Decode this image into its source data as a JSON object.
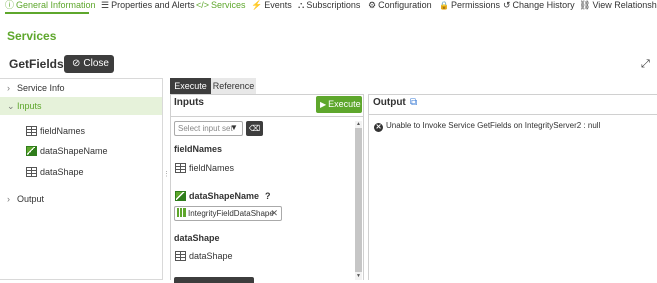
{
  "nav": {
    "tabs": [
      {
        "label": "General Information",
        "icon": "info-circle-icon",
        "glyph": "ⓘ"
      },
      {
        "label": "Properties and Alerts",
        "icon": "list-icon",
        "glyph": "☰"
      },
      {
        "label": "Services",
        "icon": "code-icon",
        "glyph": "</>"
      },
      {
        "label": "Events",
        "icon": "lightning-icon",
        "glyph": "⚡"
      },
      {
        "label": "Subscriptions",
        "icon": "subscriptions-icon",
        "glyph": "⛬"
      },
      {
        "label": "Configuration",
        "icon": "gear-icon",
        "glyph": "⚙"
      },
      {
        "label": "Permissions",
        "icon": "lock-icon",
        "glyph": "🔒"
      },
      {
        "label": "Change History",
        "icon": "history-icon",
        "glyph": "↺"
      },
      {
        "label": "View Relationships",
        "icon": "relationships-icon",
        "glyph": "⛓"
      }
    ],
    "active_tab": "Services"
  },
  "page": {
    "section_title": "Services",
    "service_name": "GetFields",
    "close_label": "Close",
    "expand_icon": "expand-arrows-icon"
  },
  "left_panel": {
    "service_info_label": "Service Info",
    "inputs_label": "Inputs",
    "inputs": [
      "fieldNames",
      "dataShapeName",
      "dataShape"
    ],
    "output_label": "Output"
  },
  "tabs": {
    "execute": "Execute",
    "reference": "Reference"
  },
  "inputs_panel": {
    "title": "Inputs",
    "execute_label": "Execute",
    "select_placeholder": "Select input set",
    "field_names_heading": "fieldNames",
    "field_names_item": "fieldNames",
    "data_shape_name_heading": "dataShapeName",
    "help_mark": "?",
    "chip_value": "IntegrityFieldDataShape",
    "data_shape_heading": "dataShape",
    "data_shape_item": "dataShape"
  },
  "output_panel": {
    "title": "Output",
    "message": "Unable to Invoke Service GetFields on IntegrityServer2 : null"
  },
  "colors": {
    "accent_green": "#5ea72c",
    "dark_button": "#3d3d3d",
    "selected_row": "#e6f2da"
  }
}
